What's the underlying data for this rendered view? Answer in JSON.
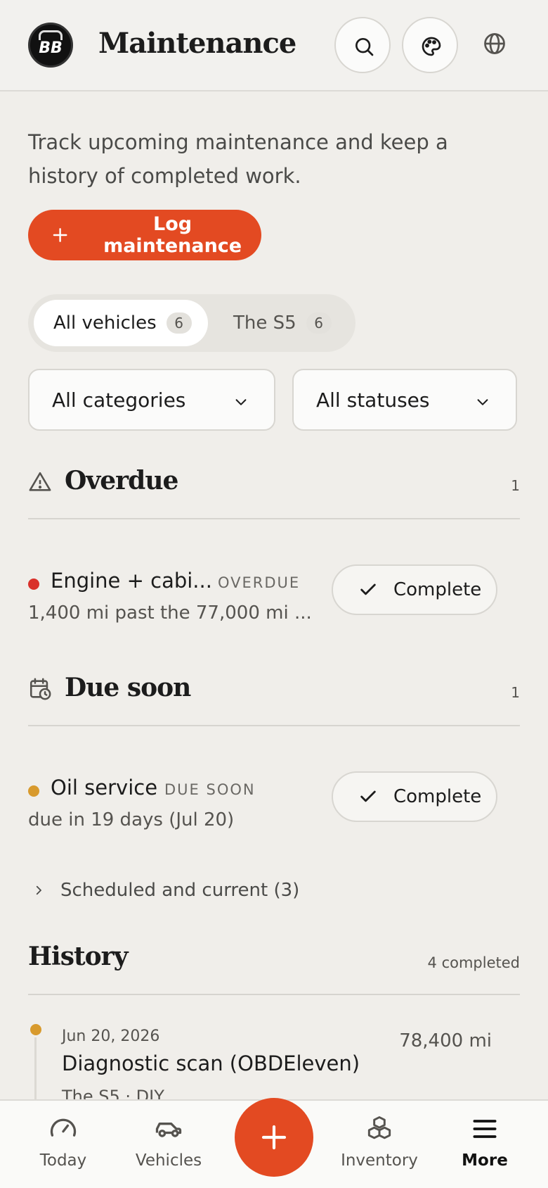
{
  "header": {
    "logo_text": "BB",
    "title": "Maintenance",
    "search_icon": "search-icon",
    "palette_icon": "palette-icon",
    "language_icon": "globe-icon"
  },
  "intro": "Track upcoming maintenance and keep a history of completed work.",
  "log_button": "Log maintenance",
  "vehicle_filter": {
    "tabs": [
      {
        "label": "All vehicles",
        "count": "6",
        "active": true
      },
      {
        "label": "The S5",
        "count": "6",
        "active": false
      }
    ]
  },
  "filters": {
    "category": "All categories",
    "status": "All statuses"
  },
  "overdue": {
    "title": "Overdue",
    "count": "1",
    "items": [
      {
        "title": "Engine + cabi...",
        "badge": "OVERDUE",
        "subtitle": "1,400 mi past the 77,000 mi ...",
        "action": "Complete",
        "dot_color": "#d9312b"
      }
    ]
  },
  "due_soon": {
    "title": "Due soon",
    "count": "1",
    "items": [
      {
        "title": "Oil service",
        "badge": "DUE SOON",
        "subtitle": "due in 19 days (Jul 20)",
        "action": "Complete",
        "dot_color": "#d89a2d"
      }
    ]
  },
  "scheduled": {
    "label": "Scheduled and current (3)"
  },
  "history": {
    "title": "History",
    "count": "4 completed",
    "items": [
      {
        "date": "Jun 20, 2026",
        "title": "Diagnostic scan (OBDEleven)",
        "subtitle": "The S5 · DIY",
        "miles": "78,400 mi"
      }
    ]
  },
  "bottom_nav": {
    "items": [
      {
        "label": "Today",
        "icon": "gauge-icon"
      },
      {
        "label": "Vehicles",
        "icon": "car-icon"
      },
      {
        "label": "Inventory",
        "icon": "boxes-icon"
      },
      {
        "label": "More",
        "icon": "menu-icon",
        "active": true
      }
    ],
    "fab_icon": "plus-icon"
  },
  "colors": {
    "accent": "#e34a22",
    "overdue": "#d9312b",
    "due_soon": "#d89a2d",
    "background": "#f0eeea"
  }
}
